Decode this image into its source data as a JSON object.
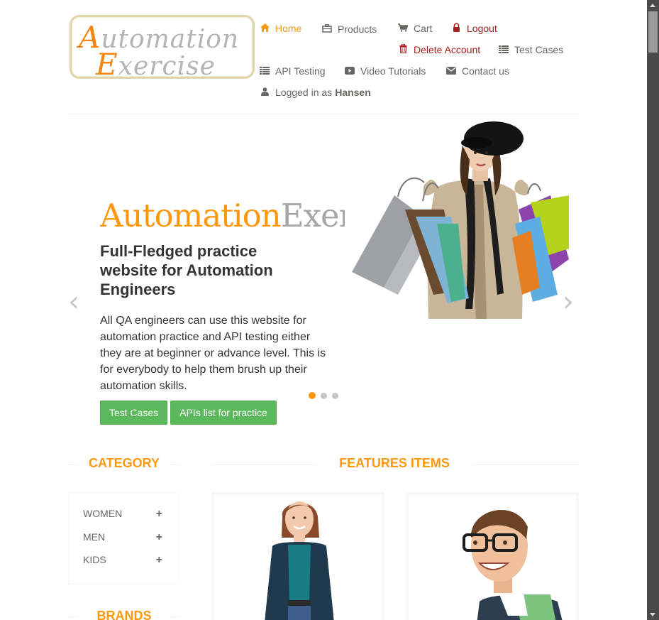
{
  "logo": {
    "line1_cap": "A",
    "line1_rest": "utomation",
    "line2_cap": "E",
    "line2_rest": "xercise"
  },
  "nav": {
    "home": "Home",
    "products": "Products",
    "cart": "Cart",
    "logout": "Logout",
    "delete_account": "Delete Account",
    "test_cases": "Test Cases",
    "api_testing": "API Testing",
    "video_tutorials": "Video Tutorials",
    "contact_us": "Contact us",
    "logged_in_prefix": "Logged in as",
    "logged_in_user": "Hansen"
  },
  "icons": {
    "home": "home-icon",
    "products": "products-icon",
    "cart": "cart-icon",
    "logout": "lock-icon",
    "delete_account": "trash-icon",
    "test_cases": "list-icon",
    "api_testing": "list-icon",
    "video_tutorials": "youtube-play-icon",
    "contact_us": "envelope-icon",
    "logged_in": "user-icon"
  },
  "slider": {
    "brand_part1": "Automation",
    "brand_part2": "Exercise",
    "heading": "Full-Fledged practice website for Automation Engineers",
    "text": "All QA engineers can use this website for automation practice and API testing either they are at beginner or advance level. This is for everybody to help them brush up their automation skills.",
    "button_test_cases": "Test Cases",
    "button_apis": "APIs list for practice",
    "prev_glyph": "‹",
    "next_glyph": "›",
    "active_slide": 1,
    "slide_count": 3
  },
  "sidebar": {
    "category_title": "CATEGORY",
    "categories": [
      {
        "label": "WOMEN",
        "toggle": "+"
      },
      {
        "label": "MEN",
        "toggle": "+"
      },
      {
        "label": "KIDS",
        "toggle": "+"
      }
    ],
    "brands_title": "BRANDS"
  },
  "main": {
    "features_title": "FEATURES ITEMS"
  },
  "colors": {
    "accent": "#FE980F",
    "danger": "#A5211D",
    "button_green": "#5CB85C",
    "text": "#696763"
  }
}
